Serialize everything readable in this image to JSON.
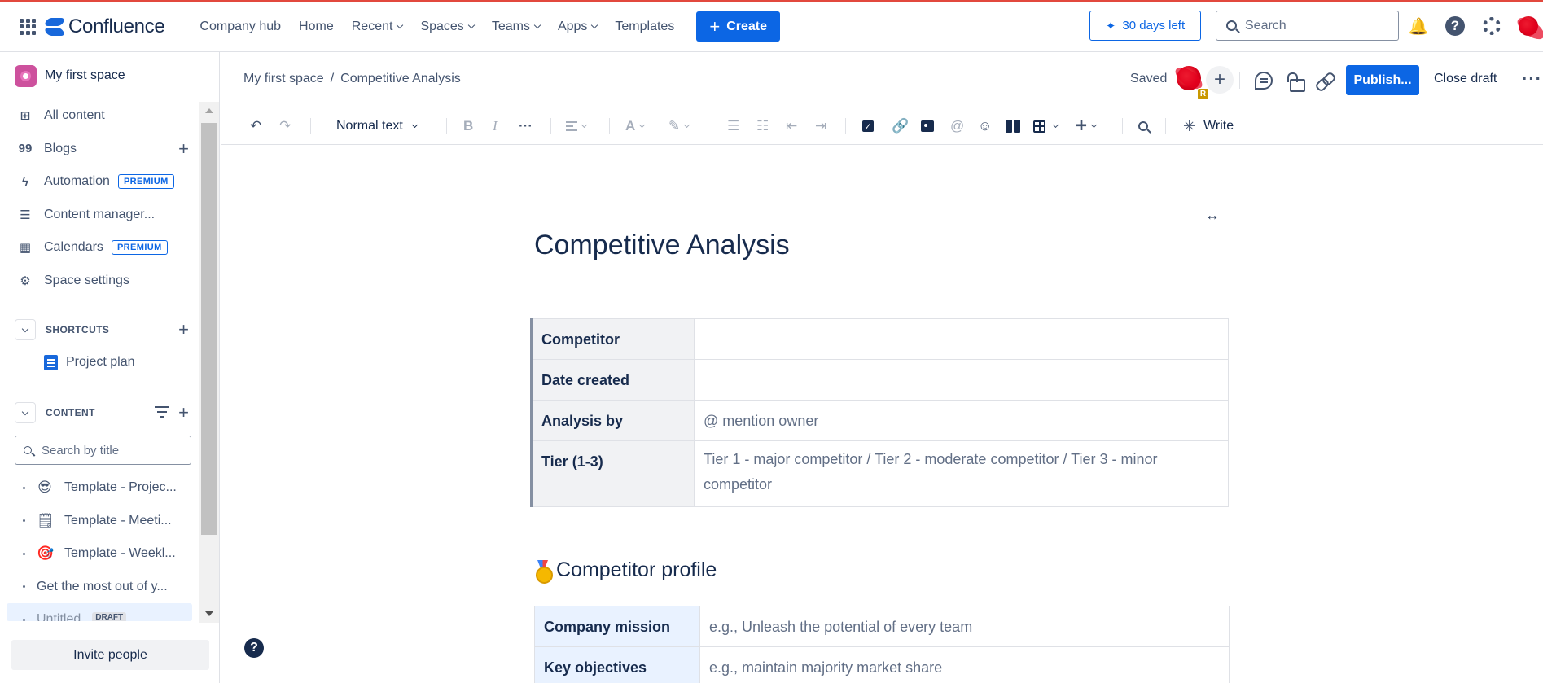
{
  "app": {
    "name": "Confluence",
    "accent_color": "#0c66e4"
  },
  "topnav": {
    "items": [
      {
        "label": "Company hub",
        "dropdown": false
      },
      {
        "label": "Home",
        "dropdown": false
      },
      {
        "label": "Recent",
        "dropdown": true
      },
      {
        "label": "Spaces",
        "dropdown": true
      },
      {
        "label": "Teams",
        "dropdown": true
      },
      {
        "label": "Apps",
        "dropdown": true
      },
      {
        "label": "Templates",
        "dropdown": false
      }
    ],
    "create_label": "Create",
    "trial_label": "30 days left",
    "search_placeholder": "Search",
    "icons": [
      "notifications-icon",
      "help-icon",
      "settings-icon",
      "profile-avatar"
    ]
  },
  "sidebar": {
    "space_name": "My first space",
    "items": [
      {
        "label": "All content",
        "icon": "grid-icon",
        "badge": "",
        "plus": false
      },
      {
        "label": "Blogs",
        "icon": "quote-icon",
        "badge": "",
        "plus": true
      },
      {
        "label": "Automation",
        "icon": "bolt-icon",
        "badge": "PREMIUM",
        "plus": false
      },
      {
        "label": "Content manager...",
        "icon": "checklist-icon",
        "badge": "",
        "plus": false
      },
      {
        "label": "Calendars",
        "icon": "calendar-icon",
        "badge": "PREMIUM",
        "plus": false
      },
      {
        "label": "Space settings",
        "icon": "gear-icon",
        "badge": "",
        "plus": false
      }
    ],
    "shortcuts_label": "SHORTCUTS",
    "shortcuts": [
      {
        "label": "Project plan"
      }
    ],
    "content_label": "CONTENT",
    "search_placeholder": "Search by title",
    "tree": [
      {
        "emoji": "😎",
        "label": "Template - Projec..."
      },
      {
        "emoji": "🗒",
        "label": "Template - Meeti..."
      },
      {
        "emoji": "🎯",
        "label": "Template - Weekl..."
      },
      {
        "emoji": "",
        "label": "Get the most out of y..."
      },
      {
        "emoji": "",
        "label": "Untitled",
        "tag": "DRAFT"
      }
    ],
    "invite_label": "Invite people"
  },
  "editor": {
    "breadcrumb": [
      "My first space",
      "Competitive Analysis"
    ],
    "breadcrumb_sep": "/",
    "saved_label": "Saved",
    "avatar_badge": "R",
    "publish_label": "Publish...",
    "close_draft_label": "Close draft",
    "toolbar": {
      "text_style": "Normal text",
      "write_label": "Write"
    }
  },
  "page": {
    "title": "Competitive Analysis",
    "info_table": [
      {
        "key": "Competitor",
        "value": ""
      },
      {
        "key": "Date created",
        "value": ""
      },
      {
        "key": "Analysis by",
        "value": "@ mention owner"
      },
      {
        "key": "Tier (1-3)",
        "value": "Tier 1 - major competitor / Tier 2 - moderate competitor / Tier 3 - minor competitor"
      }
    ],
    "section_title": "Competitor profile",
    "profile_table": [
      {
        "key": "Company mission",
        "value": "e.g., Unleash the potential of every team"
      },
      {
        "key": "Key objectives",
        "value": "e.g., maintain majority market share"
      }
    ]
  }
}
